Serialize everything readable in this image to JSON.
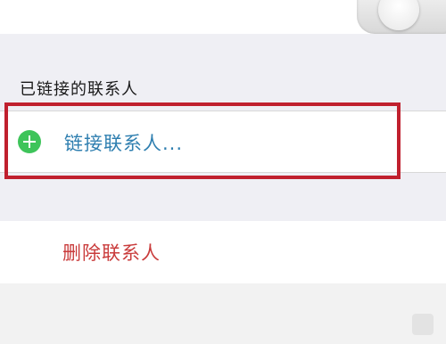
{
  "section": {
    "header": "已链接的联系人"
  },
  "link_row": {
    "icon": "add-icon",
    "label": "链接联系人..."
  },
  "delete_row": {
    "label": "删除联系人"
  },
  "colors": {
    "accent_link": "#2f7fb0",
    "add_green": "#3ec45a",
    "delete_red": "#c93b3b",
    "highlight_box": "#c0202e"
  }
}
